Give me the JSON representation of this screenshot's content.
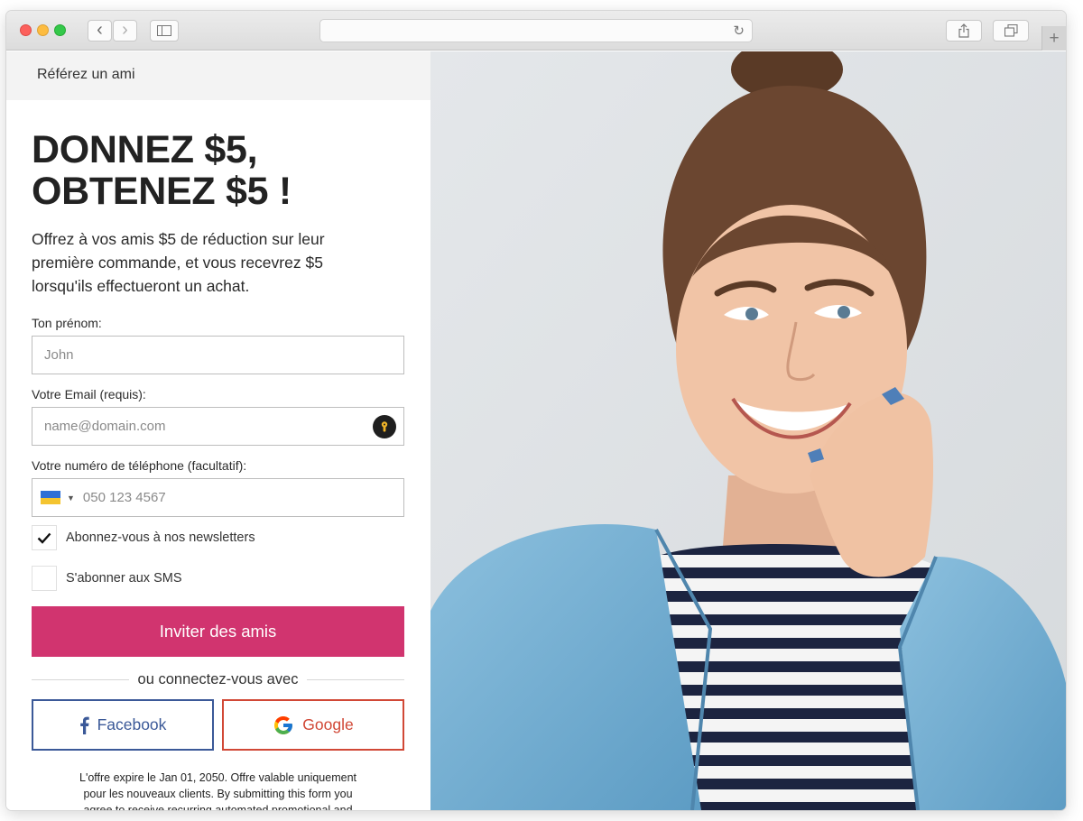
{
  "browser": {
    "nav_back": "‹",
    "nav_forward": "›",
    "reload_icon": "↻",
    "new_tab": "+"
  },
  "page": {
    "header_title": "Référez un ami",
    "headline_line1": "DONNEZ $5,",
    "headline_line2": "OBTENEZ $5 !",
    "intro_line1": "Offrez à vos amis $5 de réduction sur leur",
    "intro_line2": "première commande, et vous recevrez $5",
    "intro_line3": "lorsqu'ils effectueront un achat."
  },
  "form": {
    "first_name_label": "Ton prénom:",
    "first_name_placeholder": "John",
    "email_label": "Votre Email (requis):",
    "email_placeholder": "name@domain.com",
    "phone_label": "Votre numéro de téléphone (facultatif):",
    "phone_placeholder": "050 123 4567",
    "phone_country": "Ukraine",
    "newsletter_label": "Abonnez-vous à nos newsletters",
    "newsletter_checked": true,
    "sms_label": "S'abonner aux SMS",
    "sms_checked": false,
    "submit_label": "Inviter des amis",
    "divider_text": "ou connectez-vous avec",
    "facebook_label": "Facebook",
    "google_label": "Google",
    "fine_print_line1": "L'offre expire le Jan 01, 2050. Offre valable uniquement",
    "fine_print_line2": "pour les nouveaux clients. By submitting this form you",
    "fine_print_line3": "agree to receive recurring automated promotional and"
  },
  "colors": {
    "accent": "#d1346f",
    "facebook": "#3b5998",
    "google": "#d14836"
  }
}
